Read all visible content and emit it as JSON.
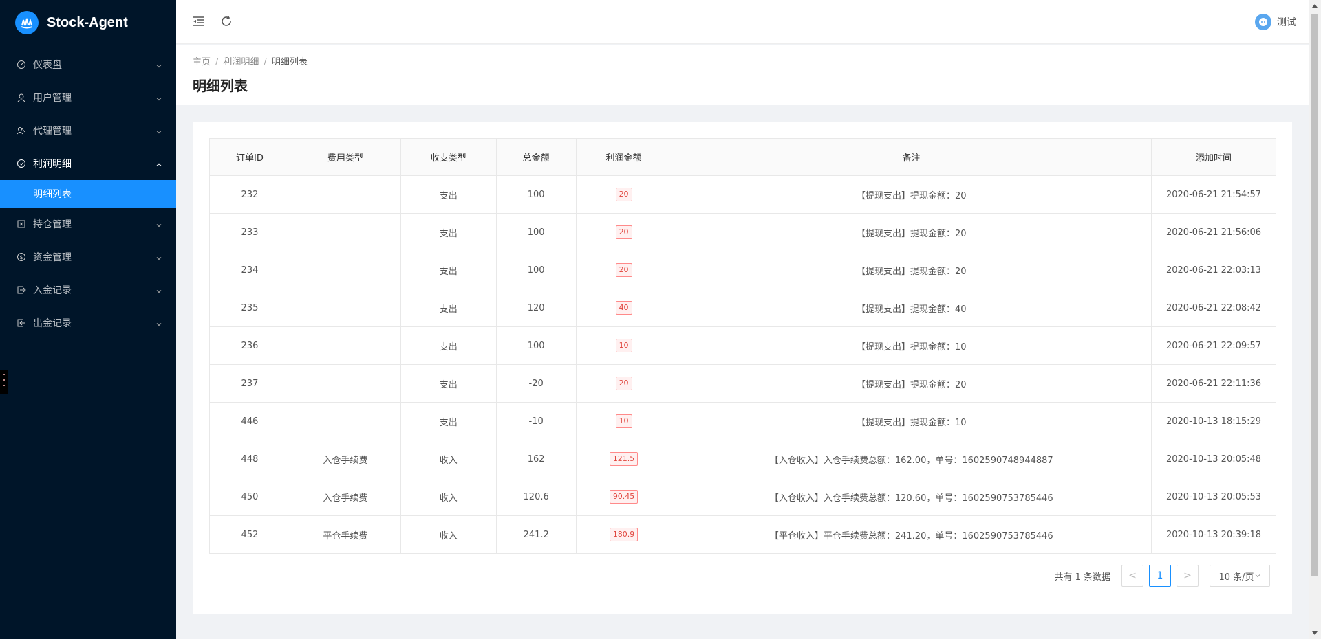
{
  "brand": {
    "title": "Stock-Agent"
  },
  "sidebar": {
    "items": [
      {
        "label": "仪表盘",
        "icon": "dashboard-icon"
      },
      {
        "label": "用户管理",
        "icon": "user-icon"
      },
      {
        "label": "代理管理",
        "icon": "team-icon"
      },
      {
        "label": "利润明细",
        "icon": "profit-icon",
        "open": true,
        "children": [
          {
            "label": "明细列表",
            "active": true
          }
        ]
      },
      {
        "label": "持仓管理",
        "icon": "position-icon"
      },
      {
        "label": "资金管理",
        "icon": "money-icon"
      },
      {
        "label": "入金记录",
        "icon": "deposit-icon"
      },
      {
        "label": "出金记录",
        "icon": "withdraw-icon"
      }
    ]
  },
  "header": {
    "user": "测试"
  },
  "breadcrumb": [
    "主页",
    "利润明细",
    "明细列表"
  ],
  "page_title": "明细列表",
  "table": {
    "columns": [
      "订单ID",
      "费用类型",
      "收支类型",
      "总金额",
      "利润金额",
      "备注",
      "添加时间"
    ],
    "rows": [
      [
        "232",
        "",
        "支出",
        "100",
        "20",
        "【提现支出】提现金额：20",
        "2020-06-21 21:54:57"
      ],
      [
        "233",
        "",
        "支出",
        "100",
        "20",
        "【提现支出】提现金额：20",
        "2020-06-21 21:56:06"
      ],
      [
        "234",
        "",
        "支出",
        "100",
        "20",
        "【提现支出】提现金额：20",
        "2020-06-21 22:03:13"
      ],
      [
        "235",
        "",
        "支出",
        "120",
        "40",
        "【提现支出】提现金额：40",
        "2020-06-21 22:08:42"
      ],
      [
        "236",
        "",
        "支出",
        "100",
        "10",
        "【提现支出】提现金额：10",
        "2020-06-21 22:09:57"
      ],
      [
        "237",
        "",
        "支出",
        "-20",
        "20",
        "【提现支出】提现金额：20",
        "2020-06-21 22:11:36"
      ],
      [
        "446",
        "",
        "支出",
        "-10",
        "10",
        "【提现支出】提现金额：10",
        "2020-10-13 18:15:29"
      ],
      [
        "448",
        "入仓手续费",
        "收入",
        "162",
        "121.5",
        "【入仓收入】入仓手续费总额：162.00，单号：1602590748944887",
        "2020-10-13 20:05:48"
      ],
      [
        "450",
        "入仓手续费",
        "收入",
        "120.6",
        "90.45",
        "【入仓收入】入仓手续费总额：120.60，单号：1602590753785446",
        "2020-10-13 20:05:53"
      ],
      [
        "452",
        "平仓手续费",
        "收入",
        "241.2",
        "180.9",
        "【平仓收入】平仓手续费总额：241.20，单号：1602590753785446",
        "2020-10-13 20:39:18"
      ]
    ]
  },
  "pagination": {
    "total_text": "共有 1 条数据",
    "current": "1",
    "prev": "<",
    "next": ">",
    "page_size": "10 条/页"
  },
  "colors": {
    "sidebar_bg": "#001529",
    "accent": "#1890ff",
    "tag_red": "#e0463e"
  }
}
